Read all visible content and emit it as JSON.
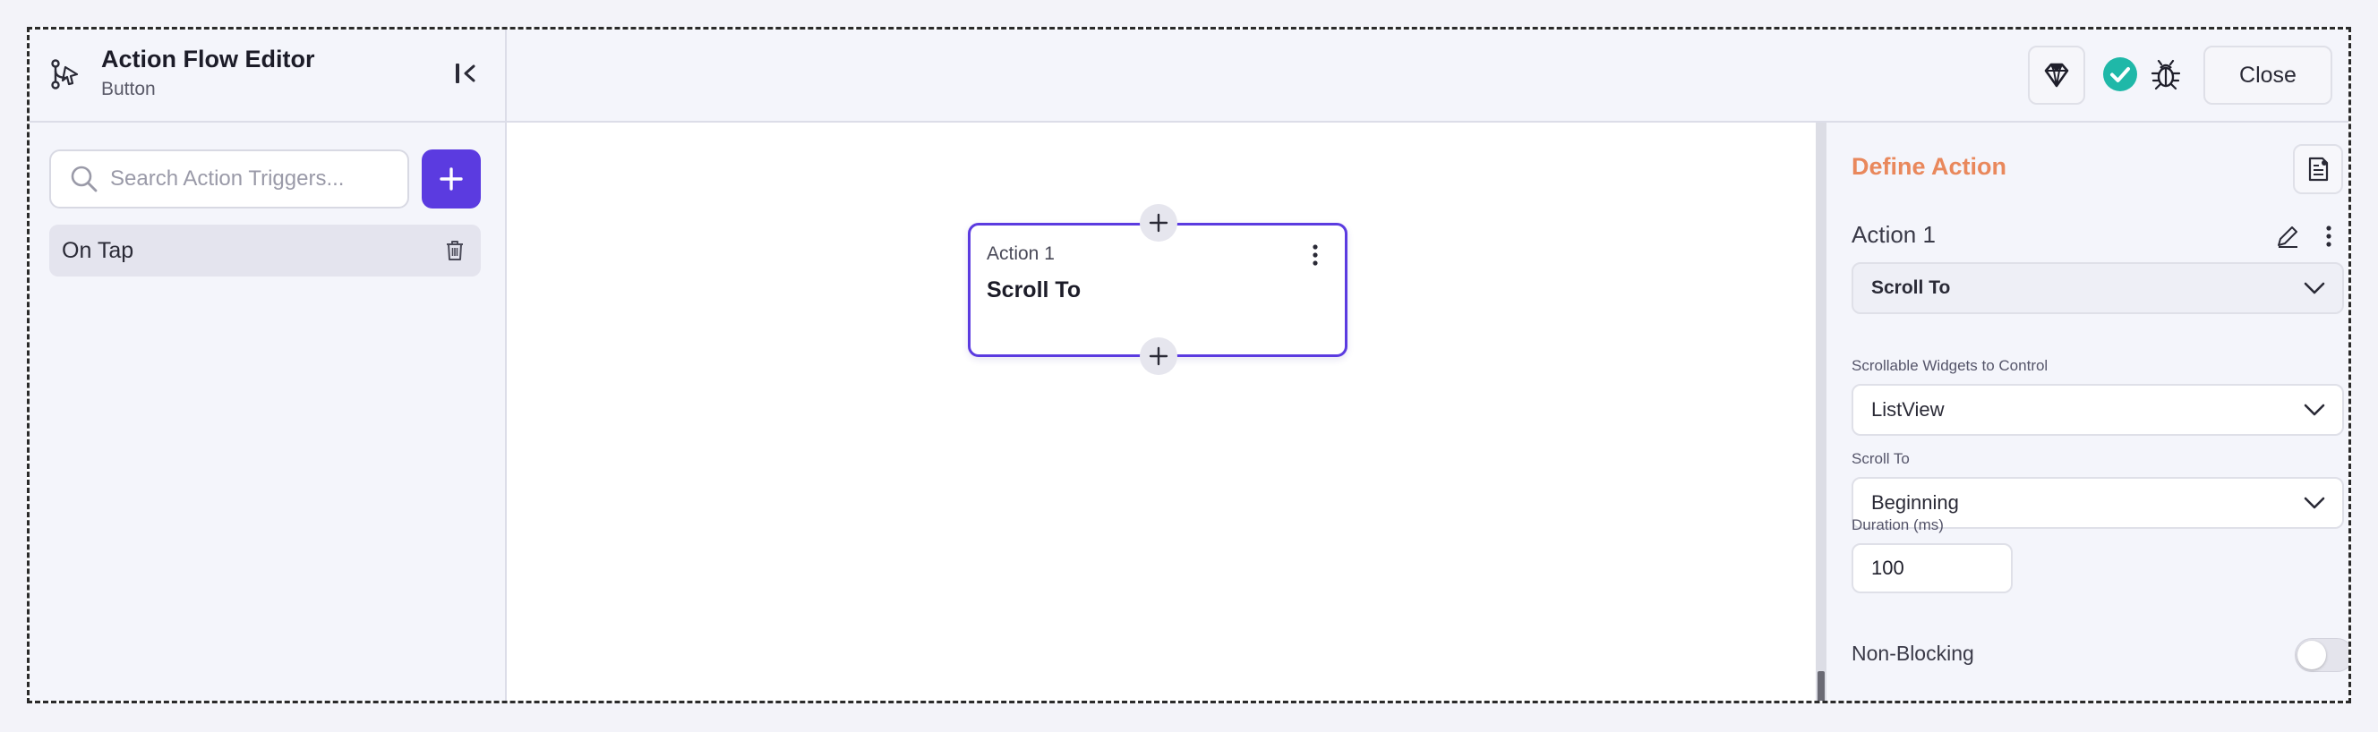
{
  "header": {
    "title": "Action Flow Editor",
    "subtitle": "Button",
    "close_label": "Close",
    "icons": [
      "flow-icon",
      "collapse-panel-icon",
      "gem-icon",
      "check-circle-icon",
      "bug-icon"
    ],
    "status_color": "#1fb8a8"
  },
  "sidebar": {
    "search": {
      "placeholder": "Search Action Triggers...",
      "value": ""
    },
    "add_icon": "plus-icon",
    "triggers": [
      {
        "label": "On Tap",
        "icon": "trash-icon"
      }
    ]
  },
  "canvas": {
    "node": {
      "label": "Action 1",
      "title": "Scroll To",
      "border_color": "#5b3be0"
    }
  },
  "panel": {
    "title": "Define Action",
    "title_color": "#e9885c",
    "action_name": "Action 1",
    "action_type": "Scroll To",
    "fields": [
      {
        "label": "Scrollable Widgets to Control",
        "value": "ListView"
      },
      {
        "label": "Scroll To",
        "value": "Beginning"
      }
    ],
    "duration": {
      "label": "Duration (ms)",
      "value": "100"
    },
    "non_blocking": {
      "label": "Non-Blocking",
      "enabled": false
    }
  },
  "colors": {
    "accent": "#5b3be0",
    "background": "#f4f5fb"
  }
}
